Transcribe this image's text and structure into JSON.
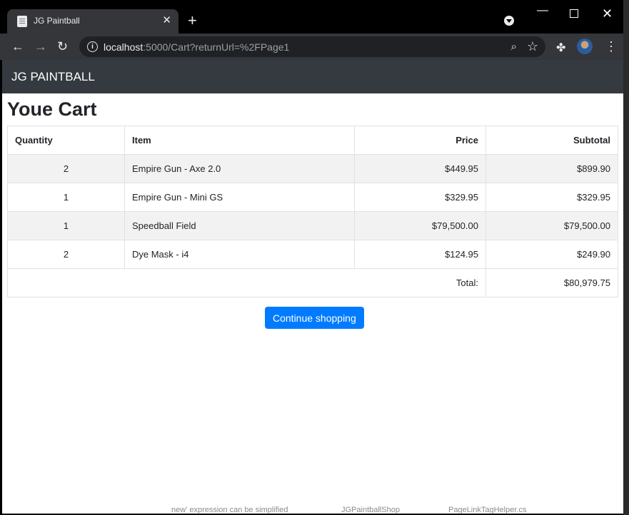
{
  "browser": {
    "tab_title": "JG Paintball",
    "url_host": "localhost",
    "url_rest": ":5000/Cart?returnUrl=%2FPage1"
  },
  "site": {
    "brand": "JG PAINTBALL"
  },
  "cart": {
    "heading": "Youe Cart",
    "columns": [
      "Quantity",
      "Item",
      "Price",
      "Subtotal"
    ],
    "rows": [
      {
        "qty": "2",
        "item": "Empire Gun - Axe 2.0",
        "price": "$449.95",
        "subtotal": "$899.90"
      },
      {
        "qty": "1",
        "item": "Empire Gun - Mini GS",
        "price": "$329.95",
        "subtotal": "$329.95"
      },
      {
        "qty": "1",
        "item": "Speedball Field",
        "price": "$79,500.00",
        "subtotal": "$79,500.00"
      },
      {
        "qty": "2",
        "item": "Dye Mask - i4",
        "price": "$124.95",
        "subtotal": "$249.90"
      }
    ],
    "total_label": "Total:",
    "total_value": "$80,979.75",
    "continue_label": "Continue shopping"
  },
  "background_fragments": [
    "new' expression can be simplified",
    "JGPaintballShop",
    "PageLinkTagHelper.cs"
  ]
}
